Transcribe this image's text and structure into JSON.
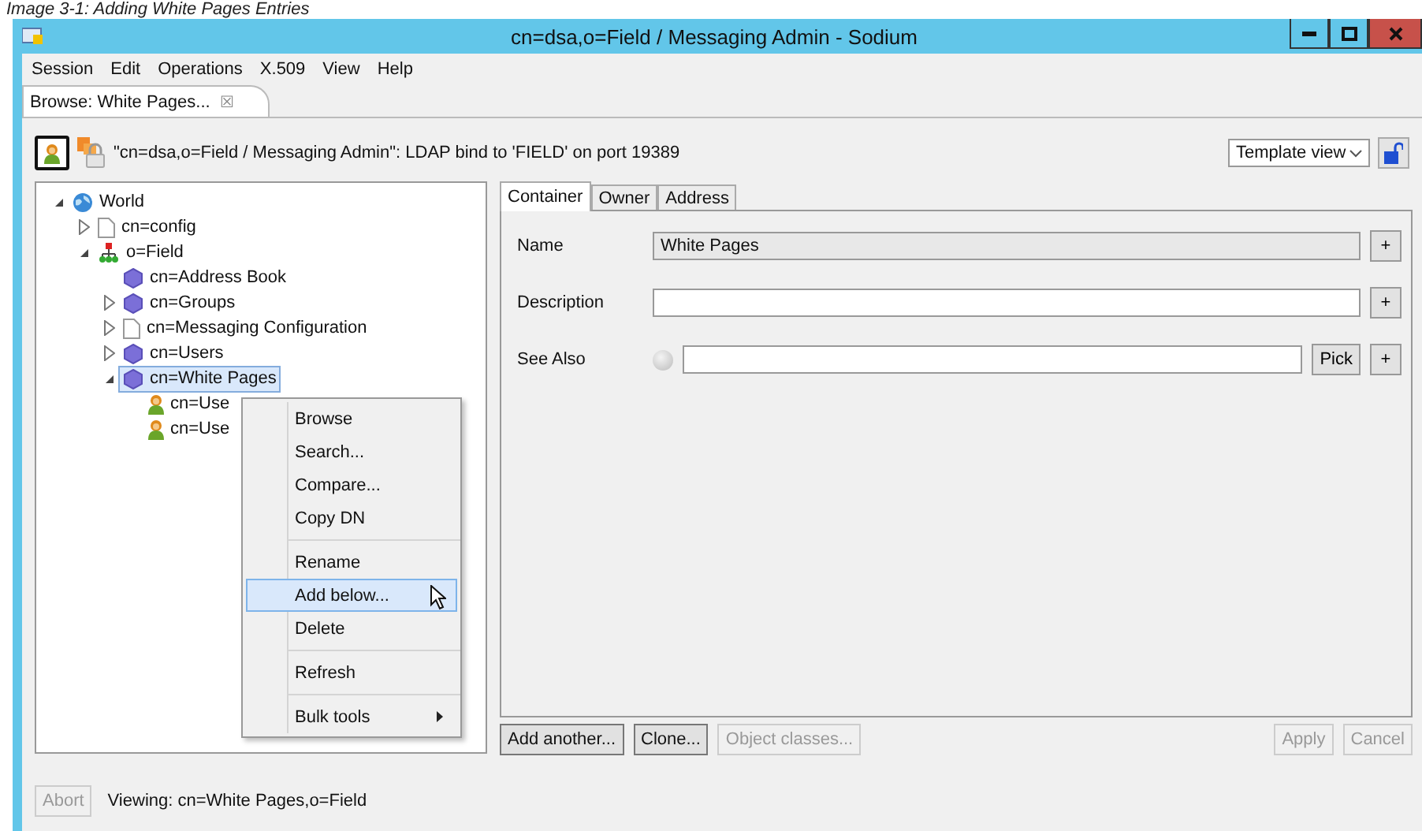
{
  "caption": "Image 3-1: Adding White Pages Entries",
  "window": {
    "title": "cn=dsa,o=Field / Messaging Admin - Sodium"
  },
  "menu_bar": [
    "Session",
    "Edit",
    "Operations",
    "X.509",
    "View",
    "Help"
  ],
  "editor_tabs": [
    {
      "label": "Browse: White Pages...",
      "close": "☒",
      "selected": true
    }
  ],
  "connection": {
    "message": "\"cn=dsa,o=Field / Messaging Admin\": LDAP bind to 'FIELD' on port 19389",
    "view_select": "Template view"
  },
  "tree": [
    {
      "label": "World",
      "kind": "globe",
      "expanded": true,
      "selected": false,
      "children": [
        {
          "label": "cn=config",
          "kind": "document",
          "expanded": false,
          "selected": false
        },
        {
          "label": "o=Field",
          "kind": "organization",
          "expanded": true,
          "selected": false,
          "children": [
            {
              "label": "cn=Address Book",
              "kind": "container",
              "selected": false
            },
            {
              "label": "cn=Groups",
              "kind": "container",
              "expanded": false,
              "selected": false
            },
            {
              "label": "cn=Messaging Configuration",
              "kind": "document",
              "expanded": false,
              "selected": false
            },
            {
              "label": "cn=Users",
              "kind": "container",
              "expanded": false,
              "selected": false
            },
            {
              "label": "cn=White Pages",
              "kind": "container",
              "expanded": true,
              "selected": true,
              "children": [
                {
                  "label": "cn=Use",
                  "kind": "person",
                  "selected": false
                },
                {
                  "label": "cn=Use",
                  "kind": "person",
                  "selected": false
                }
              ]
            }
          ]
        }
      ]
    }
  ],
  "context_menu": [
    [
      {
        "label": "Browse",
        "selected": false
      },
      {
        "label": "Search...",
        "selected": false
      },
      {
        "label": "Compare...",
        "selected": false
      },
      {
        "label": "Copy DN",
        "selected": false
      }
    ],
    [
      {
        "label": "Rename",
        "selected": false
      },
      {
        "label": "Add below...",
        "selected": true
      },
      {
        "label": "Delete",
        "selected": false
      }
    ],
    [
      {
        "label": "Refresh",
        "selected": false
      }
    ],
    [
      {
        "label": "Bulk tools",
        "selected": false,
        "submenu": true
      }
    ]
  ],
  "form_tabs": [
    {
      "label": "Container",
      "selected": true
    },
    {
      "label": "Owner",
      "selected": false
    },
    {
      "label": "Address",
      "selected": false
    }
  ],
  "fields": [
    {
      "label": "Name",
      "kind": "text",
      "value": "White Pages",
      "readonly": true,
      "add": "+"
    },
    {
      "label": "Description",
      "kind": "text",
      "readonly": false,
      "add": "+"
    },
    {
      "label": "See Also",
      "kind": "reference",
      "readonly": false,
      "radio_selected": false,
      "pick": "Pick",
      "add": "+"
    }
  ],
  "left_buttons": [
    {
      "label": "Add another...",
      "disabled": false
    },
    {
      "label": "Clone...",
      "disabled": false
    },
    {
      "label": "Object classes...",
      "disabled": true
    }
  ],
  "right_buttons": [
    {
      "label": "Apply",
      "disabled": true
    },
    {
      "label": "Cancel",
      "disabled": true
    }
  ],
  "status_bar": {
    "abort": {
      "label": "Abort",
      "disabled": true
    },
    "text": "Viewing: cn=White Pages,o=Field"
  }
}
